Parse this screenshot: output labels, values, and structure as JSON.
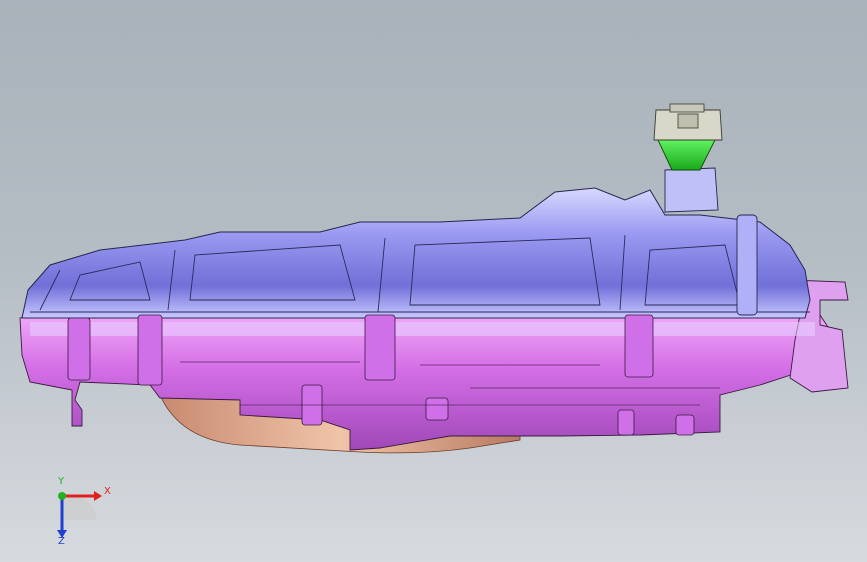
{
  "viewport": {
    "background_top": "#a9b1ba",
    "background_bottom": "#d7dbdf"
  },
  "model": {
    "colors": {
      "upper_body": "#8f8ff0",
      "upper_highlight": "#c9c9ff",
      "lower_body": "#d96ee8",
      "lower_dark": "#b04fc4",
      "filler_neck": "#2fd12f",
      "cap": "#d8d8c8",
      "under_part": "#d9a38a"
    }
  },
  "triad": {
    "x_label": "X",
    "y_label": "Y",
    "z_label": "Z",
    "x_color": "#e02020",
    "y_color": "#20b020",
    "z_color": "#2040d0"
  }
}
